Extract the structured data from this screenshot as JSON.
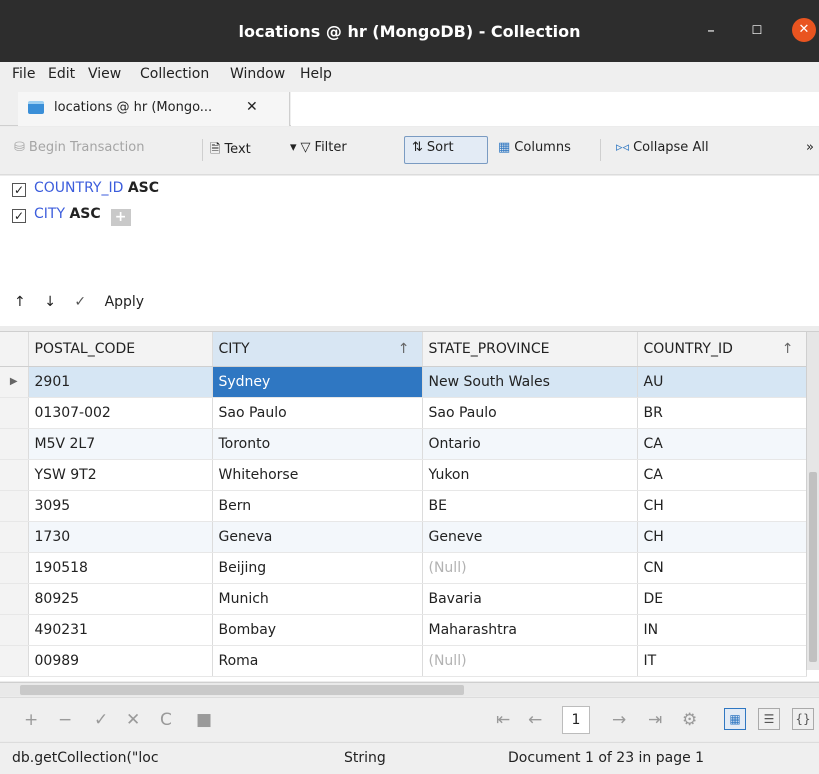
{
  "window": {
    "title": "locations @ hr (MongoDB) - Collection",
    "minimize": "–",
    "maximize": "☐",
    "close": "✕"
  },
  "menu": [
    "File",
    "Edit",
    "View",
    "Collection",
    "Window",
    "Help"
  ],
  "tab": {
    "label": "locations @ hr (Mongo...",
    "close": "✕"
  },
  "toolbar": {
    "begin_transaction": "Begin Transaction",
    "text": "Text",
    "filter": "Filter",
    "sort": "Sort",
    "columns": "Columns",
    "collapse_all": "Collapse All",
    "more": "»"
  },
  "sort_panel": {
    "rows": [
      {
        "field": "COUNTRY_ID",
        "order": "ASC",
        "checked": "✓"
      },
      {
        "field": "CITY",
        "order": "ASC",
        "checked": "✓"
      }
    ],
    "add": "+",
    "move_up": "↑",
    "move_down": "↓",
    "apply": "Apply",
    "apply_icon": "✓"
  },
  "grid": {
    "columns": [
      "POSTAL_CODE",
      "CITY",
      "STATE_PROVINCE",
      "COUNTRY_ID"
    ],
    "sort_arrow": "↑",
    "rows": [
      [
        "2901",
        "Sydney",
        "New South Wales",
        "AU"
      ],
      [
        "01307-002",
        "Sao Paulo",
        "Sao Paulo",
        "BR"
      ],
      [
        "M5V 2L7",
        "Toronto",
        "Ontario",
        "CA"
      ],
      [
        "YSW 9T2",
        "Whitehorse",
        "Yukon",
        "CA"
      ],
      [
        "3095",
        "Bern",
        "BE",
        "CH"
      ],
      [
        "1730",
        "Geneva",
        "Geneve",
        "CH"
      ],
      [
        "190518",
        "Beijing",
        "(Null)",
        "CN"
      ],
      [
        "80925",
        "Munich",
        "Bavaria",
        "DE"
      ],
      [
        "490231",
        "Bombay",
        "Maharashtra",
        "IN"
      ],
      [
        "00989",
        "Roma",
        "(Null)",
        "IT"
      ]
    ],
    "row_indicator": "▶"
  },
  "navigation": {
    "add": "+",
    "delete": "−",
    "apply": "✓",
    "discard": "✕",
    "refresh": "C",
    "stop": "■",
    "first": "⇤",
    "prev": "←",
    "page": "1",
    "next": "→",
    "last": "⇥",
    "settings": "⚙",
    "grid_view": "▦",
    "form_view": "☰",
    "json_view": "{}"
  },
  "status": {
    "query": "db.getCollection(\"loc",
    "type": "String",
    "info": "Document 1 of 23 in page 1"
  }
}
